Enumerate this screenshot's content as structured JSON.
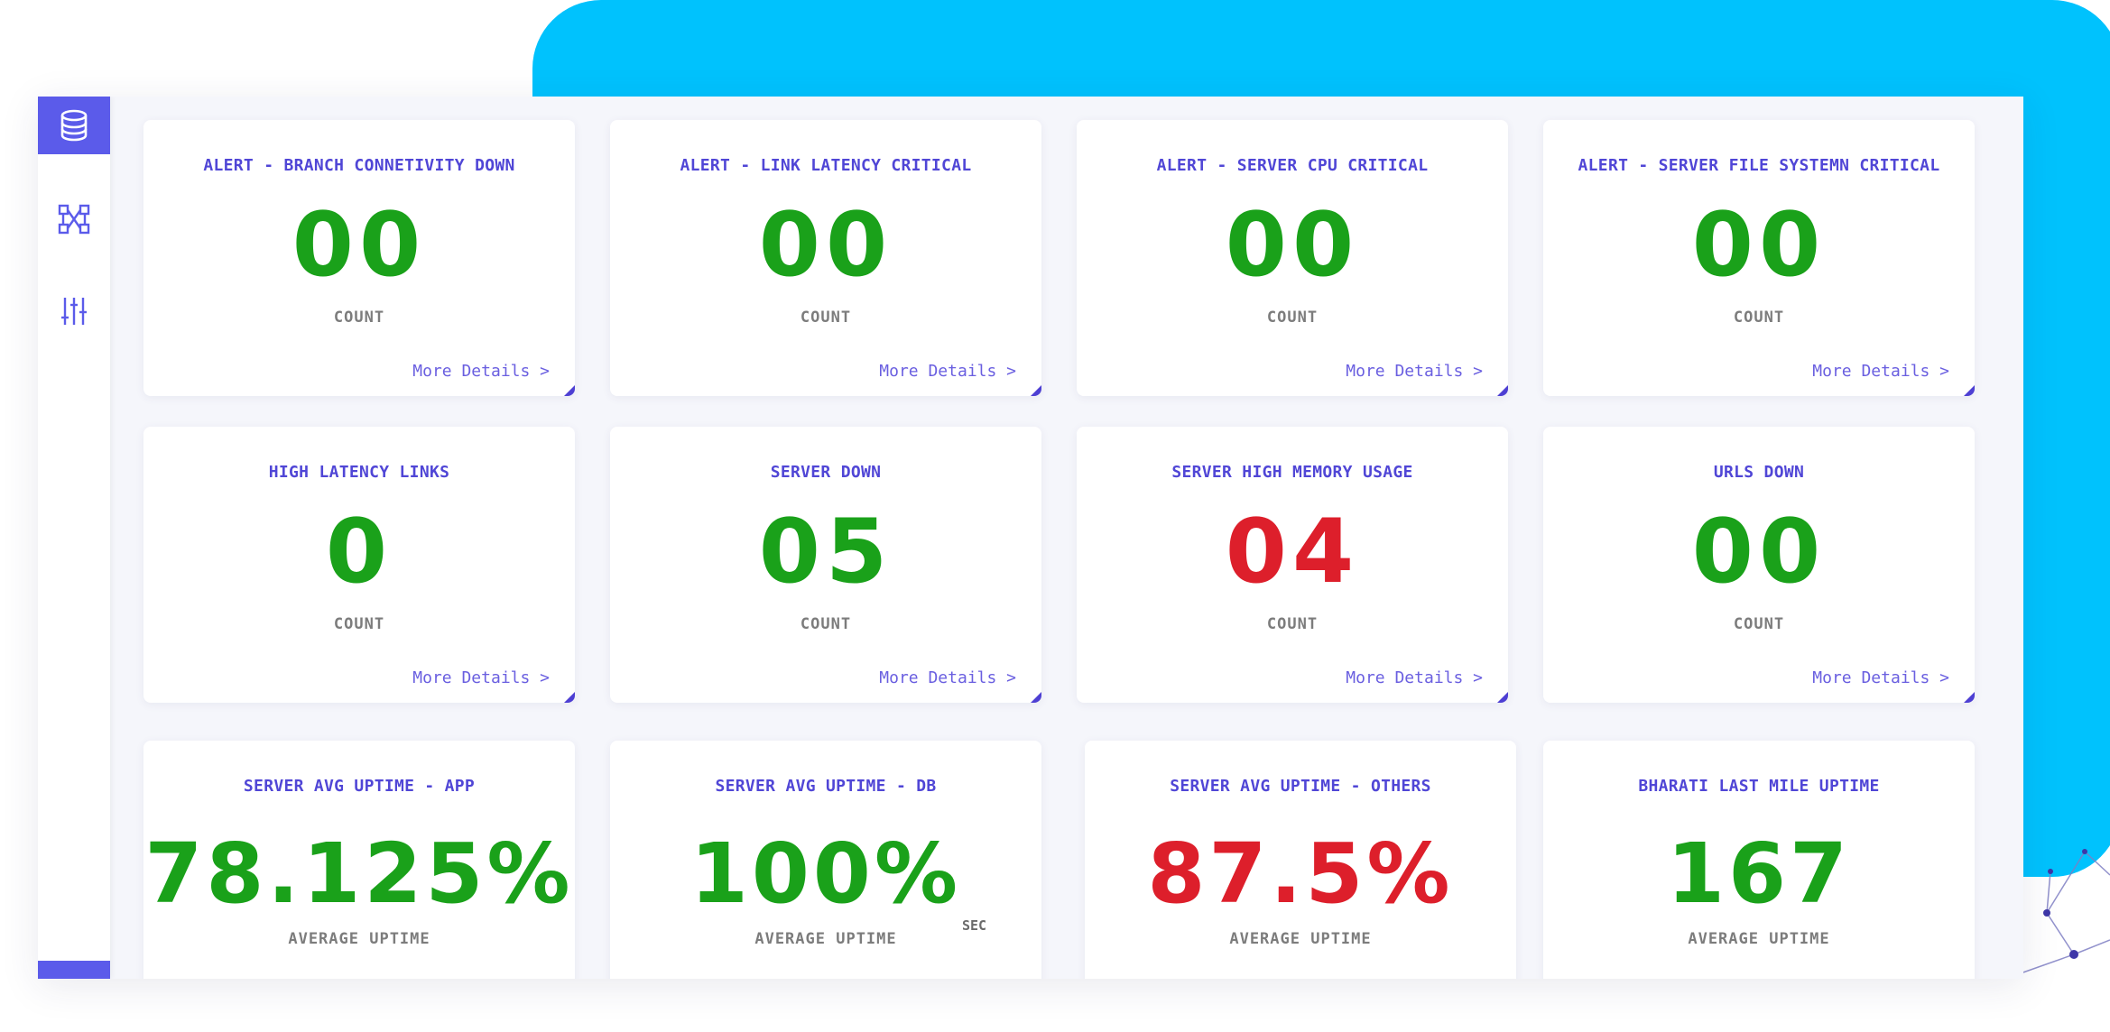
{
  "theme": {
    "green": "#1aa11a",
    "red": "#dd1f2b",
    "accent": "#5b5bea",
    "backdrop": "#00c2fd"
  },
  "sidebar": {
    "items": [
      {
        "icon": "database-icon",
        "active": true
      },
      {
        "icon": "network-topology-icon",
        "active": false
      },
      {
        "icon": "sliders-icon",
        "active": false
      }
    ]
  },
  "alert_cards": [
    {
      "title": "ALERT - BRANCH CONNETIVITY DOWN",
      "value": "00",
      "status": "green",
      "label": "COUNT",
      "link": "More Details >"
    },
    {
      "title": "ALERT - LINK LATENCY CRITICAL",
      "value": "00",
      "status": "green",
      "label": "COUNT",
      "link": "More Details >"
    },
    {
      "title": "ALERT - SERVER CPU CRITICAL",
      "value": "00",
      "status": "green",
      "label": "COUNT",
      "link": "More Details >"
    },
    {
      "title": "ALERT - SERVER FILE SYSTEMN CRITICAL",
      "value": "00",
      "status": "green",
      "label": "COUNT",
      "link": "More Details >"
    },
    {
      "title": "HIGH LATENCY LINKS",
      "value": "0",
      "status": "green",
      "label": "COUNT",
      "link": "More Details >"
    },
    {
      "title": "SERVER DOWN",
      "value": "05",
      "status": "green",
      "label": "COUNT",
      "link": "More Details >"
    },
    {
      "title": "SERVER HIGH MEMORY USAGE",
      "value": "04",
      "status": "red",
      "label": "COUNT",
      "link": "More Details >"
    },
    {
      "title": "URLS DOWN",
      "value": "00",
      "status": "green",
      "label": "COUNT",
      "link": "More Details >"
    }
  ],
  "uptime_cards": [
    {
      "title": "SERVER AVG UPTIME - APP",
      "value": "78.125%",
      "status": "green",
      "label": "AVERAGE UPTIME"
    },
    {
      "title": "SERVER AVG UPTIME - DB",
      "value": "100%",
      "status": "green",
      "label": "AVERAGE UPTIME",
      "unit": "SEC"
    },
    {
      "title": "SERVER AVG UPTIME - OTHERS",
      "value": "87.5%",
      "status": "red",
      "label": "AVERAGE UPTIME"
    },
    {
      "title": "BHARATI LAST MILE UPTIME",
      "value": "167",
      "status": "green",
      "label": "AVERAGE UPTIME"
    }
  ]
}
